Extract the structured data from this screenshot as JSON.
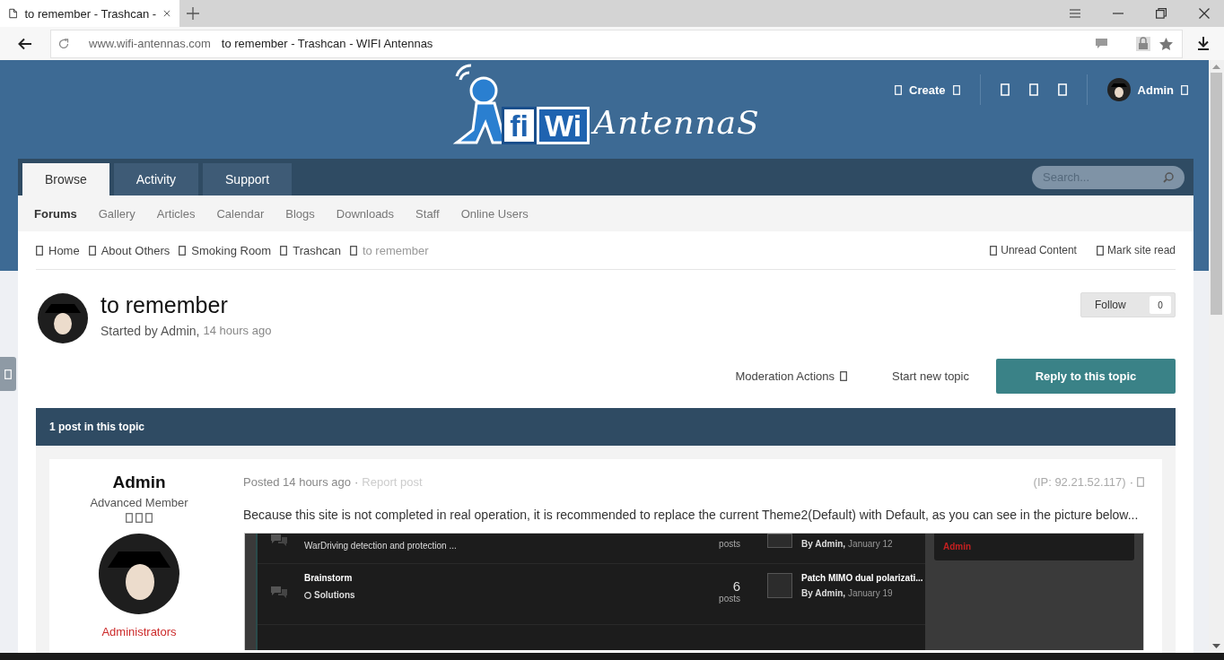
{
  "browser": {
    "tab_title": "to remember - Trashcan -",
    "domain": "www.wifi-antennas.com",
    "page_title": "to remember - Trashcan - WIFI Antennas"
  },
  "header": {
    "logo": [
      "fi",
      "Wi",
      "AntennaS"
    ],
    "create_label": "Create",
    "user_name": "Admin"
  },
  "nav": {
    "tabs": [
      {
        "label": "Browse",
        "selected": true
      },
      {
        "label": "Activity",
        "selected": false
      },
      {
        "label": "Support",
        "selected": false
      }
    ],
    "search": {
      "placeholder": "Search..."
    }
  },
  "subnav": [
    {
      "label": "Forums",
      "selected": true
    },
    {
      "label": "Gallery",
      "selected": false
    },
    {
      "label": "Articles",
      "selected": false
    },
    {
      "label": "Calendar",
      "selected": false
    },
    {
      "label": "Blogs",
      "selected": false
    },
    {
      "label": "Downloads",
      "selected": false
    },
    {
      "label": "Staff",
      "selected": false
    },
    {
      "label": "Online Users",
      "selected": false
    }
  ],
  "breadcrumb": [
    {
      "label": "Home",
      "current": false
    },
    {
      "label": "About Others",
      "current": false
    },
    {
      "label": "Smoking Room",
      "current": false
    },
    {
      "label": "Trashcan",
      "current": false
    },
    {
      "label": "to remember",
      "current": true
    }
  ],
  "breadcrumb_actions": [
    "Unread Content",
    "Mark site read"
  ],
  "topic": {
    "title": "to remember",
    "started_by": "Started by Admin,",
    "time": "14 hours ago",
    "follow_label": "Follow",
    "follow_count": "0"
  },
  "actions": {
    "moderation": "Moderation Actions",
    "start_topic": "Start new topic",
    "reply": "Reply to this topic"
  },
  "post_count": "1 post in this topic",
  "post": {
    "author": {
      "name": "Admin",
      "rank": "Advanced Member",
      "group": "Administrators"
    },
    "posted": "Posted 14 hours ago",
    "separator": "·",
    "report": "Report post",
    "ip": "(IP: 92.21.52.117)",
    "ip_separator": "·",
    "body": "Because this site is not completed in real operation, it is recommended to replace the current Theme2(Default) with Default, as you can see in the picture below...",
    "screenshot": {
      "rows": [
        {
          "description": "WarDriving detection and protection ...",
          "count_label": "posts",
          "last_by": "By Admin,",
          "last_date": "January 12"
        },
        {
          "title": "Brainstorm",
          "subforum": "Solutions",
          "count": "6",
          "count_label": "posts",
          "last_title": "Patch MIMO dual polarizati...",
          "last_by": "By Admin,",
          "last_date": "January 19"
        }
      ],
      "sidebar_user": "Admin"
    }
  }
}
